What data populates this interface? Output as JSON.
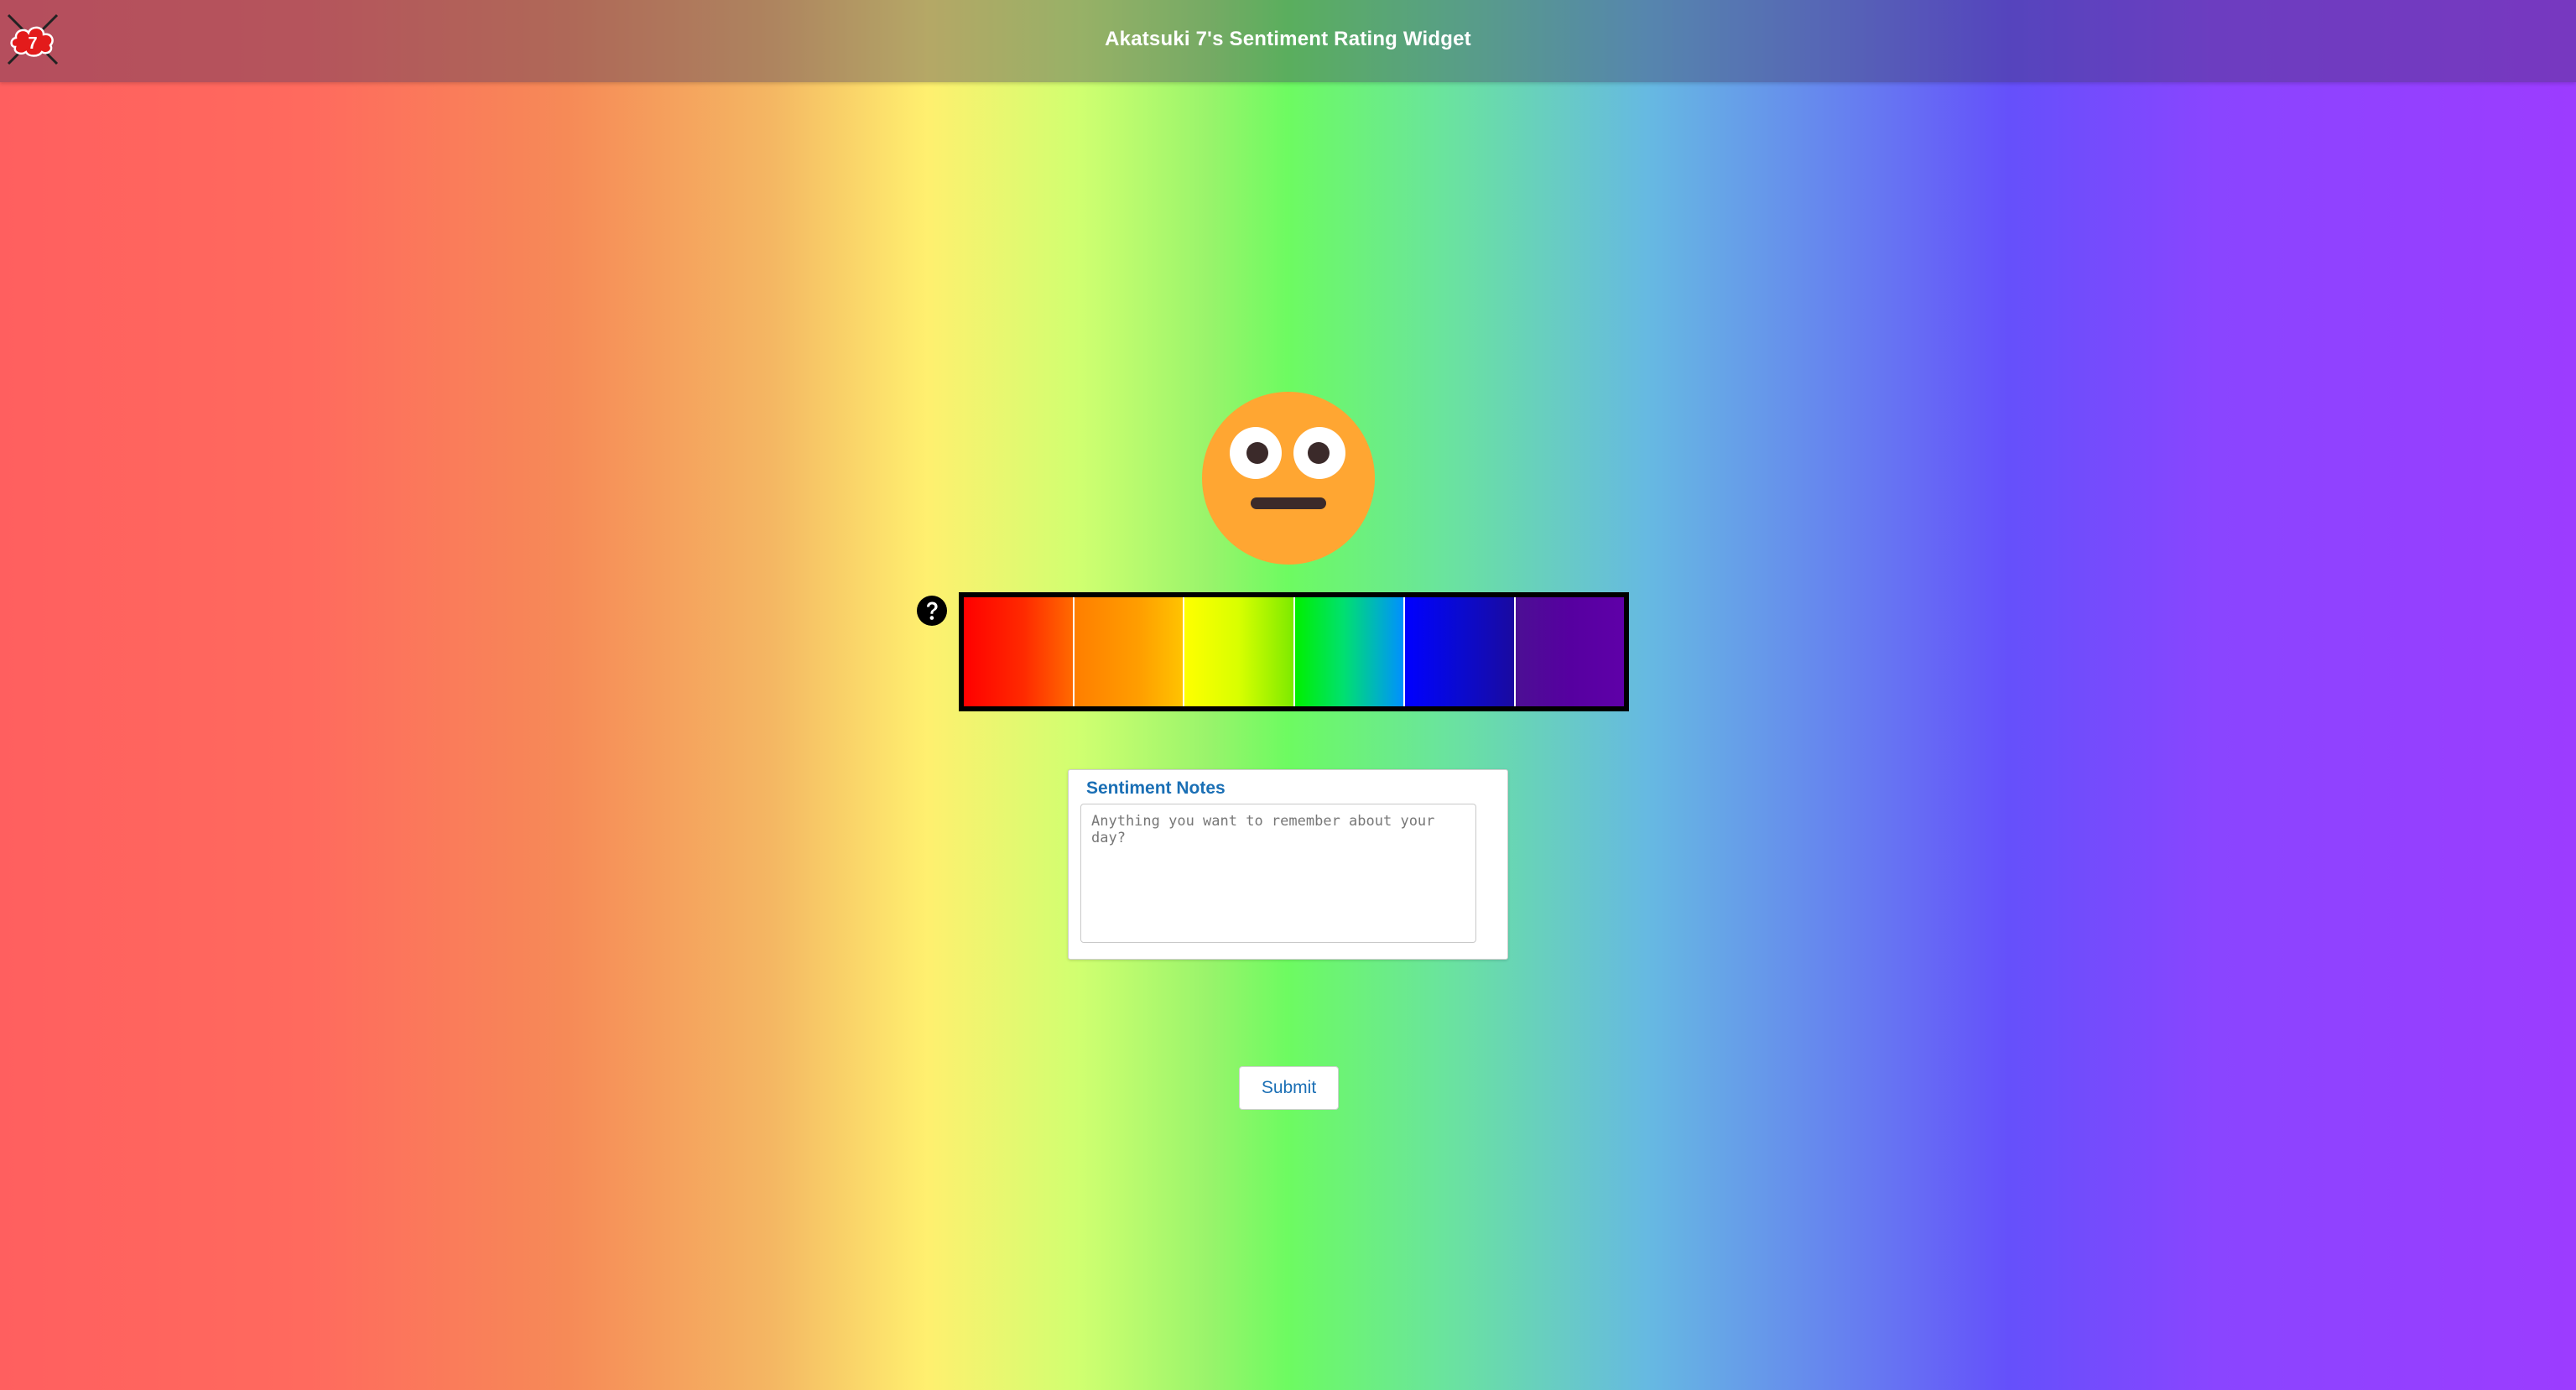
{
  "header": {
    "title": "Akatsuki 7's Sentiment Rating Widget",
    "logo_icon": "akatsuki-cloud-logo-icon"
  },
  "mood_display": {
    "icon": "flushed-face-emoji-icon",
    "face_color": "#FFA632"
  },
  "rating_scale": {
    "help_icon": "question-circle-icon",
    "segments": [
      {
        "level": 1,
        "color": "#FF0000"
      },
      {
        "level": 2,
        "color": "#FF9E00"
      },
      {
        "level": 3,
        "color": "#D8FF00"
      },
      {
        "level": 4,
        "color": "#00E070"
      },
      {
        "level": 5,
        "color": "#0A0AD0"
      },
      {
        "level": 6,
        "color": "#5600A0"
      }
    ]
  },
  "notes": {
    "label": "Sentiment Notes",
    "placeholder": "Anything you want to remember about your day?",
    "value": ""
  },
  "actions": {
    "submit_label": "Submit"
  },
  "colors": {
    "accent": "#1A6FB5"
  }
}
